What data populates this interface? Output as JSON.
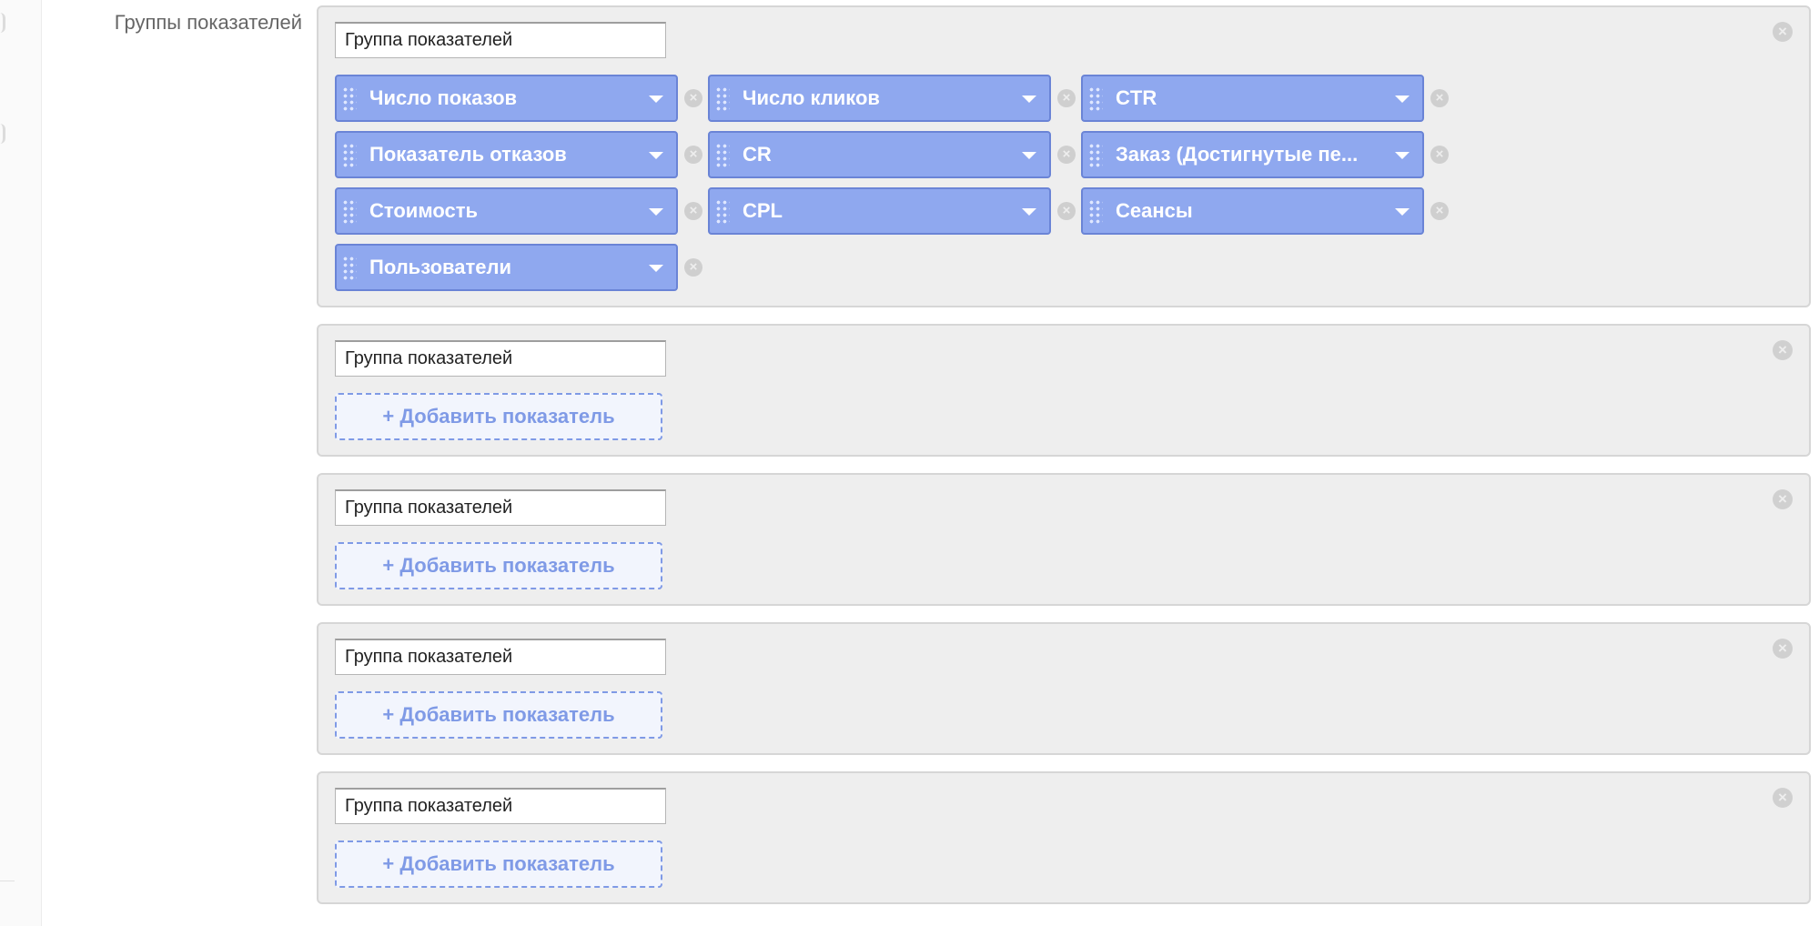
{
  "section": {
    "label": "Группы показателей"
  },
  "remove_icon_glyph": "×",
  "groups": [
    {
      "name": "Группа показателей",
      "metrics": [
        {
          "label": "Число показов"
        },
        {
          "label": "Число кликов"
        },
        {
          "label": "CTR"
        },
        {
          "label": "Показатель отказов"
        },
        {
          "label": "CR"
        },
        {
          "label": "Заказ (Достигнутые пе..."
        },
        {
          "label": "Стоимость"
        },
        {
          "label": "CPL"
        },
        {
          "label": "Сеансы"
        },
        {
          "label": "Пользователи"
        }
      ]
    },
    {
      "name": "Группа показателей",
      "add_label": "+ Добавить показатель"
    },
    {
      "name": "Группа показателей",
      "add_label": "+ Добавить показатель"
    },
    {
      "name": "Группа показателей",
      "add_label": "+ Добавить показатель"
    },
    {
      "name": "Группа показателей",
      "add_label": "+ Добавить показатель"
    }
  ],
  "colors": {
    "metric_fill": "#8fa8ef",
    "metric_border": "#6a84d6",
    "group_bg": "#eeeeee",
    "add_link": "#7f9ae6"
  }
}
